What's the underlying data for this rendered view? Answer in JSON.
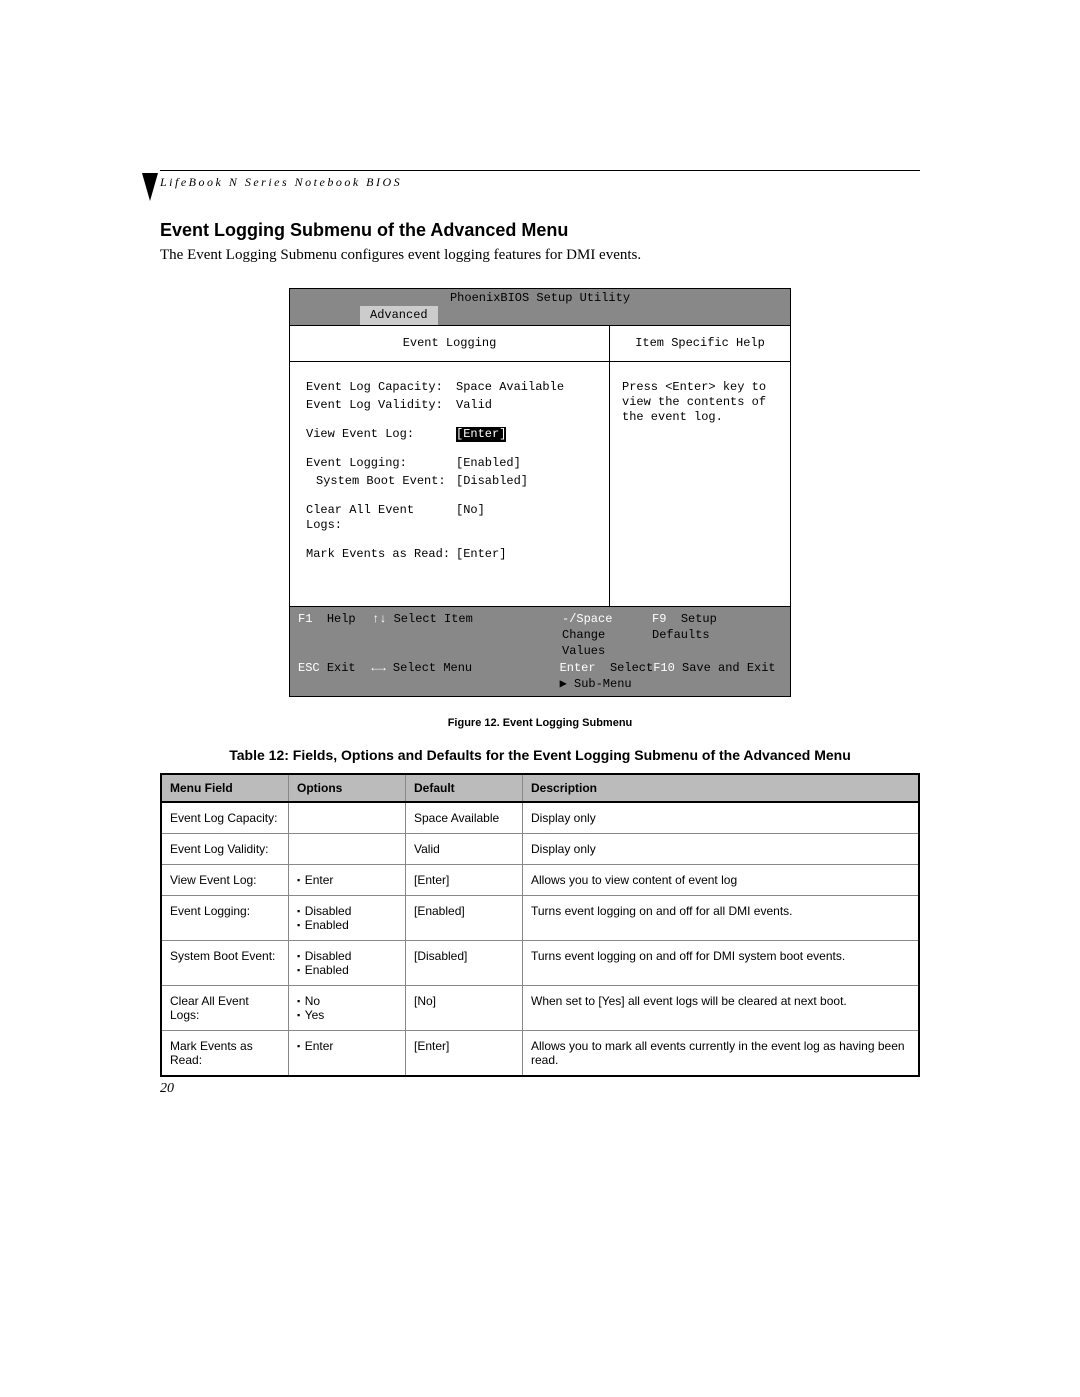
{
  "header": {
    "running_head": "LifeBook N Series Notebook BIOS"
  },
  "section": {
    "title": "Event Logging Submenu of the Advanced Menu",
    "intro": "The Event Logging Submenu configures event logging features for DMI events."
  },
  "bios": {
    "window_title": "PhoenixBIOS Setup Utility",
    "active_tab": "Advanced",
    "panel_title": "Event Logging",
    "help_title": "Item Specific Help",
    "help_text": "Press <Enter> key to view the contents of the event log.",
    "fields": [
      {
        "label": "Event Log Capacity:",
        "value": "Space Available",
        "hilite": false,
        "indent": false,
        "gap": ""
      },
      {
        "label": "Event Log Validity:",
        "value": "Valid",
        "hilite": false,
        "indent": false,
        "gap": "gap-small"
      },
      {
        "label": "View Event Log:",
        "value": "[Enter]",
        "hilite": true,
        "indent": false,
        "gap": "gap-small"
      },
      {
        "label": "Event Logging:",
        "value": "[Enabled]",
        "hilite": false,
        "indent": false,
        "gap": ""
      },
      {
        "label": "System Boot Event:",
        "value": "[Disabled]",
        "hilite": false,
        "indent": true,
        "gap": "gap-small"
      },
      {
        "label": "Clear All Event Logs:",
        "value": "[No]",
        "hilite": false,
        "indent": false,
        "gap": "gap-small"
      },
      {
        "label": "Mark Events as Read:",
        "value": "[Enter]",
        "hilite": false,
        "indent": false,
        "gap": ""
      }
    ],
    "footer": {
      "r1c1_key": "F1",
      "r1c1_text": "Help",
      "r1c2_key": "↑↓",
      "r1c2_text": "Select Item",
      "r1c3_key": "-/Space",
      "r1c3_text": "Change Values",
      "r1c4_key": "F9",
      "r1c4_text": "Setup Defaults",
      "r2c1_key": "ESC",
      "r2c1_text": "Exit",
      "r2c2_key": "←→",
      "r2c2_text": "Select Menu",
      "r2c3_key": "Enter",
      "r2c3_text": "Select ▶ Sub-Menu",
      "r2c4_key": "F10",
      "r2c4_text": "Save and Exit"
    }
  },
  "figure_caption": "Figure 12.  Event Logging Submenu",
  "table_caption": "Table 12: Fields, Options and Defaults for the Event Logging Submenu of the Advanced Menu",
  "table": {
    "headers": [
      "Menu Field",
      "Options",
      "Default",
      "Description"
    ],
    "rows": [
      {
        "menu": "Event Log Capacity:",
        "options": [],
        "default": "Space Available",
        "desc": "Display only"
      },
      {
        "menu": "Event Log Validity:",
        "options": [],
        "default": "Valid",
        "desc": "Display only"
      },
      {
        "menu": "View Event Log:",
        "options": [
          "Enter"
        ],
        "default": "[Enter]",
        "desc": "Allows you to view content of event log"
      },
      {
        "menu": "Event Logging:",
        "options": [
          "Disabled",
          "Enabled"
        ],
        "default": "[Enabled]",
        "desc": "Turns event logging on and off for all DMI events."
      },
      {
        "menu": "System Boot Event:",
        "options": [
          "Disabled",
          "Enabled"
        ],
        "default": "[Disabled]",
        "desc": "Turns event logging on and off for DMI system boot events."
      },
      {
        "menu": "Clear All Event Logs:",
        "options": [
          "No",
          "Yes"
        ],
        "default": "[No]",
        "desc": "When set to [Yes] all event logs will be cleared at next boot."
      },
      {
        "menu": "Mark Events as Read:",
        "options": [
          "Enter"
        ],
        "default": "[Enter]",
        "desc": "Allows you to mark all events currently in the event log as having been read."
      }
    ]
  },
  "page_number": "20"
}
